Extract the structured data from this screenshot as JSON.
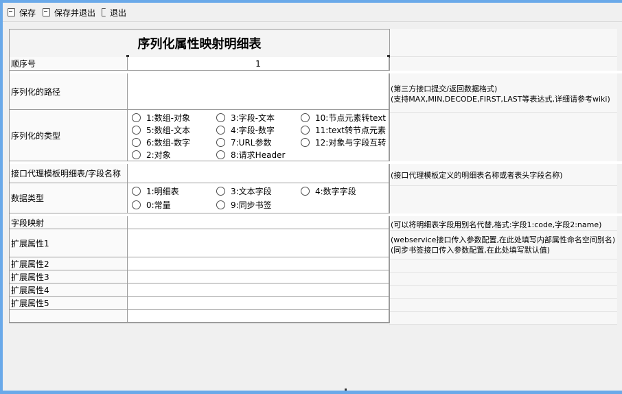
{
  "toolbar": {
    "save": "保存",
    "save_exit": "保存并退出",
    "exit": "退出"
  },
  "form": {
    "title": "序列化属性映射明细表",
    "seq_label": "顺序号",
    "seq_value": "1",
    "path_label": "序列化的路径",
    "path_note_1": "(第三方接口提交/返回数据格式)",
    "path_note_2": "(支持MAX,MIN,DECODE,FIRST,LAST等表达式,详细请参考wiki)",
    "type_label": "序列化的类型",
    "type_options": [
      "1:数组-对象",
      "3:字段-文本",
      "10:节点元素转text",
      "5:数组-文本",
      "4:字段-数字",
      "11:text转节点元素",
      "6:数组-数字",
      "7:URL参数",
      "12:对象与字段互转",
      "2:对象",
      "8:请求Header"
    ],
    "proxy_label": "接口代理模板明细表/字段名称",
    "proxy_note": "(接口代理模板定义的明细表名称或者表头字段名称)",
    "dtype_label": "数据类型",
    "dtype_options": [
      "1:明细表",
      "3:文本字段",
      "4:数字字段",
      "0:常量",
      "9:同步书签"
    ],
    "mapping_label": "字段映射",
    "mapping_note": "(可以将明细表字段用别名代替,格式:字段1:code,字段2:name)",
    "ext1_label": "扩展属性1",
    "ext1_note_1": "(webservice接口传入参数配置,在此处填写内部属性命名空间别名)",
    "ext1_note_2": "(同步书签接口传入参数配置,在此处填写默认值)",
    "ext2_label": "扩展属性2",
    "ext3_label": "扩展属性3",
    "ext4_label": "扩展属性4",
    "ext5_label": "扩展属性5"
  }
}
